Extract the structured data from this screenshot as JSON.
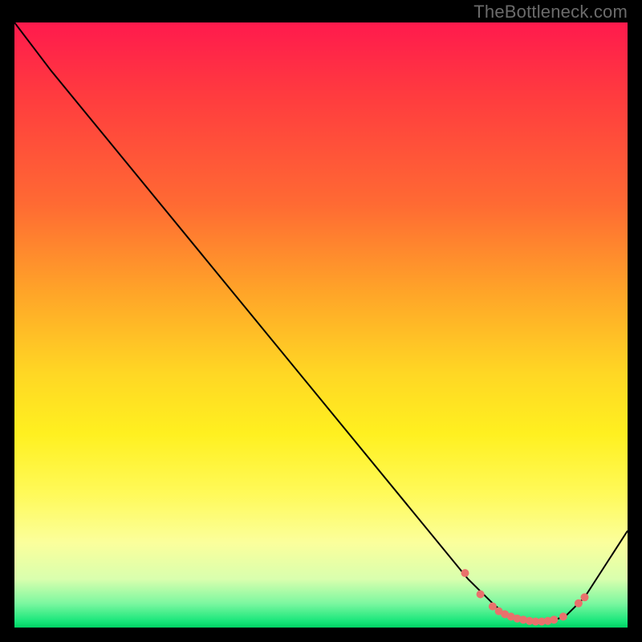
{
  "watermark": "TheBottleneck.com",
  "colors": {
    "curve": "#000000",
    "markers": "#e9716c",
    "gradient_top": "#ff1a4d",
    "gradient_bottom": "#00d264"
  },
  "chart_data": {
    "type": "line",
    "title": "",
    "xlabel": "",
    "ylabel": "",
    "xlim": [
      0,
      100
    ],
    "ylim": [
      0,
      100
    ],
    "grid": false,
    "legend": false,
    "series": [
      {
        "name": "curve",
        "x": [
          0,
          6,
          74,
          78,
          80,
          82,
          84,
          86,
          88,
          90,
          93,
          100
        ],
        "y": [
          100,
          92,
          8,
          4,
          2.2,
          1.4,
          1.0,
          1.0,
          1.2,
          2.0,
          5,
          16
        ]
      }
    ],
    "highlighted_points": {
      "name": "markers",
      "x": [
        73.5,
        76,
        78,
        79,
        80,
        81,
        82,
        83,
        84,
        85,
        86,
        87,
        88,
        89.5,
        92,
        93
      ],
      "y": [
        9,
        5.5,
        3.5,
        2.7,
        2.2,
        1.8,
        1.5,
        1.3,
        1.1,
        1.0,
        1.0,
        1.1,
        1.3,
        1.8,
        4.0,
        5.0
      ]
    }
  }
}
